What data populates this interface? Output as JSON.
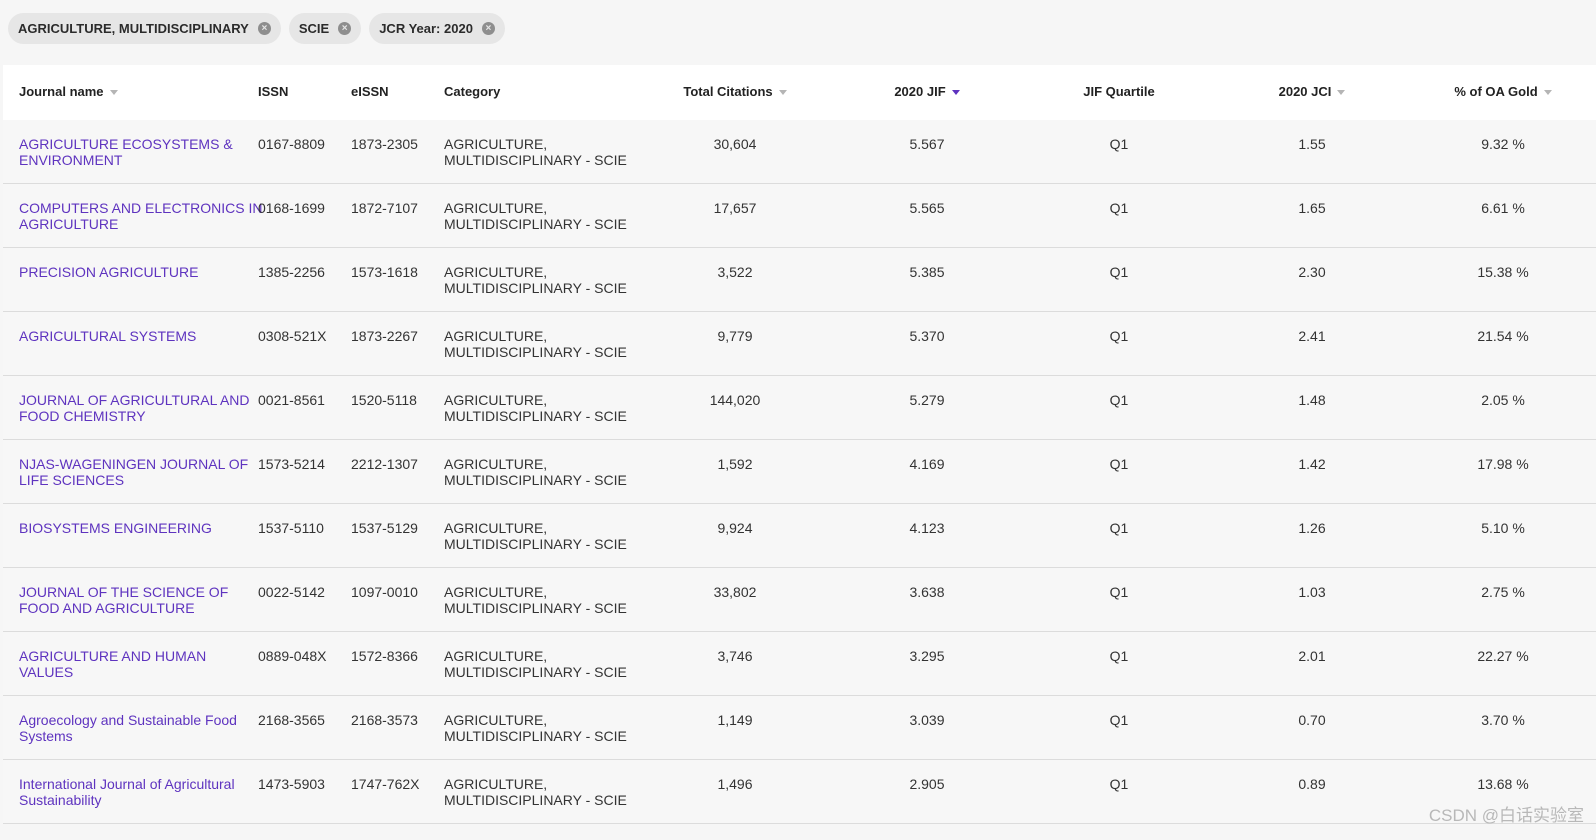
{
  "filters": [
    {
      "label": "AGRICULTURE, MULTIDISCIPLINARY"
    },
    {
      "label": "SCIE"
    },
    {
      "label": "JCR Year: 2020"
    }
  ],
  "columns": {
    "name": "Journal name",
    "issn": "ISSN",
    "eissn": "eISSN",
    "category": "Category",
    "citations": "Total Citations",
    "jif": "2020 JIF",
    "quartile": "JIF Quartile",
    "jci": "2020 JCI",
    "oa": "% of OA Gold"
  },
  "rows": [
    {
      "name": "AGRICULTURE ECOSYSTEMS & ENVIRONMENT",
      "issn": "0167-8809",
      "eissn": "1873-2305",
      "category": "AGRICULTURE, MULTIDISCIPLINARY - SCIE",
      "citations": "30,604",
      "jif": "5.567",
      "quartile": "Q1",
      "jci": "1.55",
      "oa": "9.32 %"
    },
    {
      "name": "COMPUTERS AND ELECTRONICS IN AGRICULTURE",
      "issn": "0168-1699",
      "eissn": "1872-7107",
      "category": "AGRICULTURE, MULTIDISCIPLINARY - SCIE",
      "citations": "17,657",
      "jif": "5.565",
      "quartile": "Q1",
      "jci": "1.65",
      "oa": "6.61 %"
    },
    {
      "name": "PRECISION AGRICULTURE",
      "issn": "1385-2256",
      "eissn": "1573-1618",
      "category": "AGRICULTURE, MULTIDISCIPLINARY - SCIE",
      "citations": "3,522",
      "jif": "5.385",
      "quartile": "Q1",
      "jci": "2.30",
      "oa": "15.38 %"
    },
    {
      "name": "AGRICULTURAL SYSTEMS",
      "issn": "0308-521X",
      "eissn": "1873-2267",
      "category": "AGRICULTURE, MULTIDISCIPLINARY - SCIE",
      "citations": "9,779",
      "jif": "5.370",
      "quartile": "Q1",
      "jci": "2.41",
      "oa": "21.54 %"
    },
    {
      "name": "JOURNAL OF AGRICULTURAL AND FOOD CHEMISTRY",
      "issn": "0021-8561",
      "eissn": "1520-5118",
      "category": "AGRICULTURE, MULTIDISCIPLINARY - SCIE",
      "citations": "144,020",
      "jif": "5.279",
      "quartile": "Q1",
      "jci": "1.48",
      "oa": "2.05 %"
    },
    {
      "name": "NJAS-WAGENINGEN JOURNAL OF LIFE SCIENCES",
      "issn": "1573-5214",
      "eissn": "2212-1307",
      "category": "AGRICULTURE, MULTIDISCIPLINARY - SCIE",
      "citations": "1,592",
      "jif": "4.169",
      "quartile": "Q1",
      "jci": "1.42",
      "oa": "17.98 %"
    },
    {
      "name": "BIOSYSTEMS ENGINEERING",
      "issn": "1537-5110",
      "eissn": "1537-5129",
      "category": "AGRICULTURE, MULTIDISCIPLINARY - SCIE",
      "citations": "9,924",
      "jif": "4.123",
      "quartile": "Q1",
      "jci": "1.26",
      "oa": "5.10 %"
    },
    {
      "name": "JOURNAL OF THE SCIENCE OF FOOD AND AGRICULTURE",
      "issn": "0022-5142",
      "eissn": "1097-0010",
      "category": "AGRICULTURE, MULTIDISCIPLINARY - SCIE",
      "citations": "33,802",
      "jif": "3.638",
      "quartile": "Q1",
      "jci": "1.03",
      "oa": "2.75 %"
    },
    {
      "name": "AGRICULTURE AND HUMAN VALUES",
      "issn": "0889-048X",
      "eissn": "1572-8366",
      "category": "AGRICULTURE, MULTIDISCIPLINARY - SCIE",
      "citations": "3,746",
      "jif": "3.295",
      "quartile": "Q1",
      "jci": "2.01",
      "oa": "22.27 %"
    },
    {
      "name": "Agroecology and Sustainable Food Systems",
      "issn": "2168-3565",
      "eissn": "2168-3573",
      "category": "AGRICULTURE, MULTIDISCIPLINARY - SCIE",
      "citations": "1,149",
      "jif": "3.039",
      "quartile": "Q1",
      "jci": "0.70",
      "oa": "3.70 %"
    },
    {
      "name": "International Journal of Agricultural Sustainability",
      "issn": "1473-5903",
      "eissn": "1747-762X",
      "category": "AGRICULTURE, MULTIDISCIPLINARY - SCIE",
      "citations": "1,496",
      "jif": "2.905",
      "quartile": "Q1",
      "jci": "0.89",
      "oa": "13.68 %"
    }
  ],
  "watermark": "CSDN @白话实验室",
  "colors": {
    "link": "#5e33bf",
    "sort_active": "#5e33bf",
    "sort_inactive": "#b5b5b5"
  }
}
